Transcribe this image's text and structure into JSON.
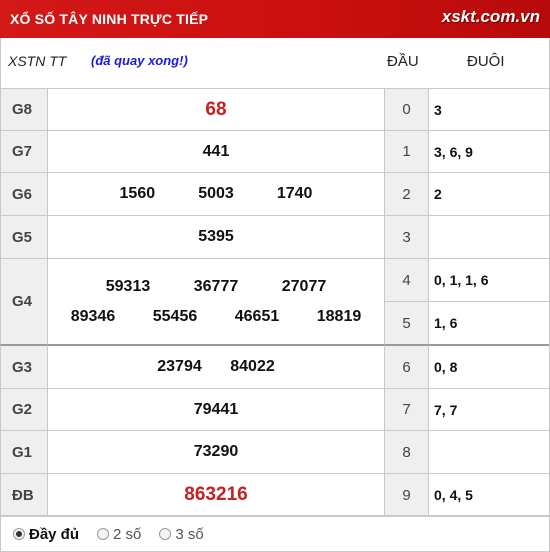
{
  "header": {
    "title": "XỔ SỐ TÂY NINH TRỰC TIẾP",
    "logo": "xskt.com.vn"
  },
  "subheader": {
    "code": "XSTN TT",
    "status": "(đã quay xong!)",
    "head_label": "ĐẦU",
    "tail_label": "ĐUÔI"
  },
  "prizes": [
    {
      "label": "G8",
      "numbers": [
        "68"
      ]
    },
    {
      "label": "G7",
      "numbers": [
        "441"
      ]
    },
    {
      "label": "G6",
      "numbers": [
        "1560",
        "5003",
        "1740"
      ]
    },
    {
      "label": "G5",
      "numbers": [
        "5395"
      ]
    },
    {
      "label": "G4",
      "numbers": [
        "59313",
        "36777",
        "27077",
        "89346",
        "55456",
        "46651",
        "18819"
      ]
    },
    {
      "label": "G3",
      "numbers": [
        "23794",
        "84022"
      ]
    },
    {
      "label": "G2",
      "numbers": [
        "79441"
      ]
    },
    {
      "label": "G1",
      "numbers": [
        "73290"
      ]
    },
    {
      "label": "ĐB",
      "numbers": [
        "863216"
      ]
    }
  ],
  "loto": [
    {
      "head": "0",
      "tails": "3"
    },
    {
      "head": "1",
      "tails": "3, 6, 9"
    },
    {
      "head": "2",
      "tails": "2"
    },
    {
      "head": "3",
      "tails": ""
    },
    {
      "head": "4",
      "tails": "0, 1, 1, 6"
    },
    {
      "head": "5",
      "tails": "1, 6"
    },
    {
      "head": "6",
      "tails": "0, 8"
    },
    {
      "head": "7",
      "tails": "7, 7"
    },
    {
      "head": "8",
      "tails": ""
    },
    {
      "head": "9",
      "tails": "0, 4, 5"
    }
  ],
  "footer": {
    "options": [
      "Đầy đủ",
      "2 số",
      "3 số"
    ],
    "selected": "Đầy đủ"
  },
  "colors": {
    "header_bg": "#c90f0f",
    "special_number": "#c81f1f",
    "status": "#1a1adf"
  }
}
